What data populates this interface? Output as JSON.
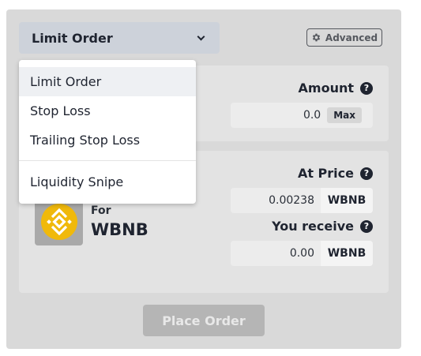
{
  "order_type": {
    "selected": "Limit Order"
  },
  "advanced_button": {
    "label": "Advanced",
    "icon": "gear-icon"
  },
  "amount": {
    "label": "Amount",
    "help": "?",
    "value": "0.0",
    "max_label": "Max"
  },
  "at_price": {
    "label": "At Price",
    "help": "?",
    "value": "0.00238",
    "unit": "WBNB"
  },
  "you_receive": {
    "label": "You receive",
    "help": "?",
    "value": "0.00",
    "unit": "WBNB"
  },
  "for_token": {
    "label": "For",
    "symbol": "WBNB",
    "icon": "bnb-logo-icon"
  },
  "place_order": {
    "label": "Place Order"
  },
  "dropdown": {
    "items": [
      {
        "label": "Limit Order",
        "active": true
      },
      {
        "label": "Stop Loss",
        "active": false
      },
      {
        "label": "Trailing Stop Loss",
        "active": false
      },
      {
        "label": "Liquidity Snipe",
        "active": false
      }
    ]
  },
  "colors": {
    "panel": "#d9d9d9",
    "card": "#e3e3e3",
    "bnb_yellow": "#f0b90b",
    "disabled_button": "#b5b5b5"
  }
}
